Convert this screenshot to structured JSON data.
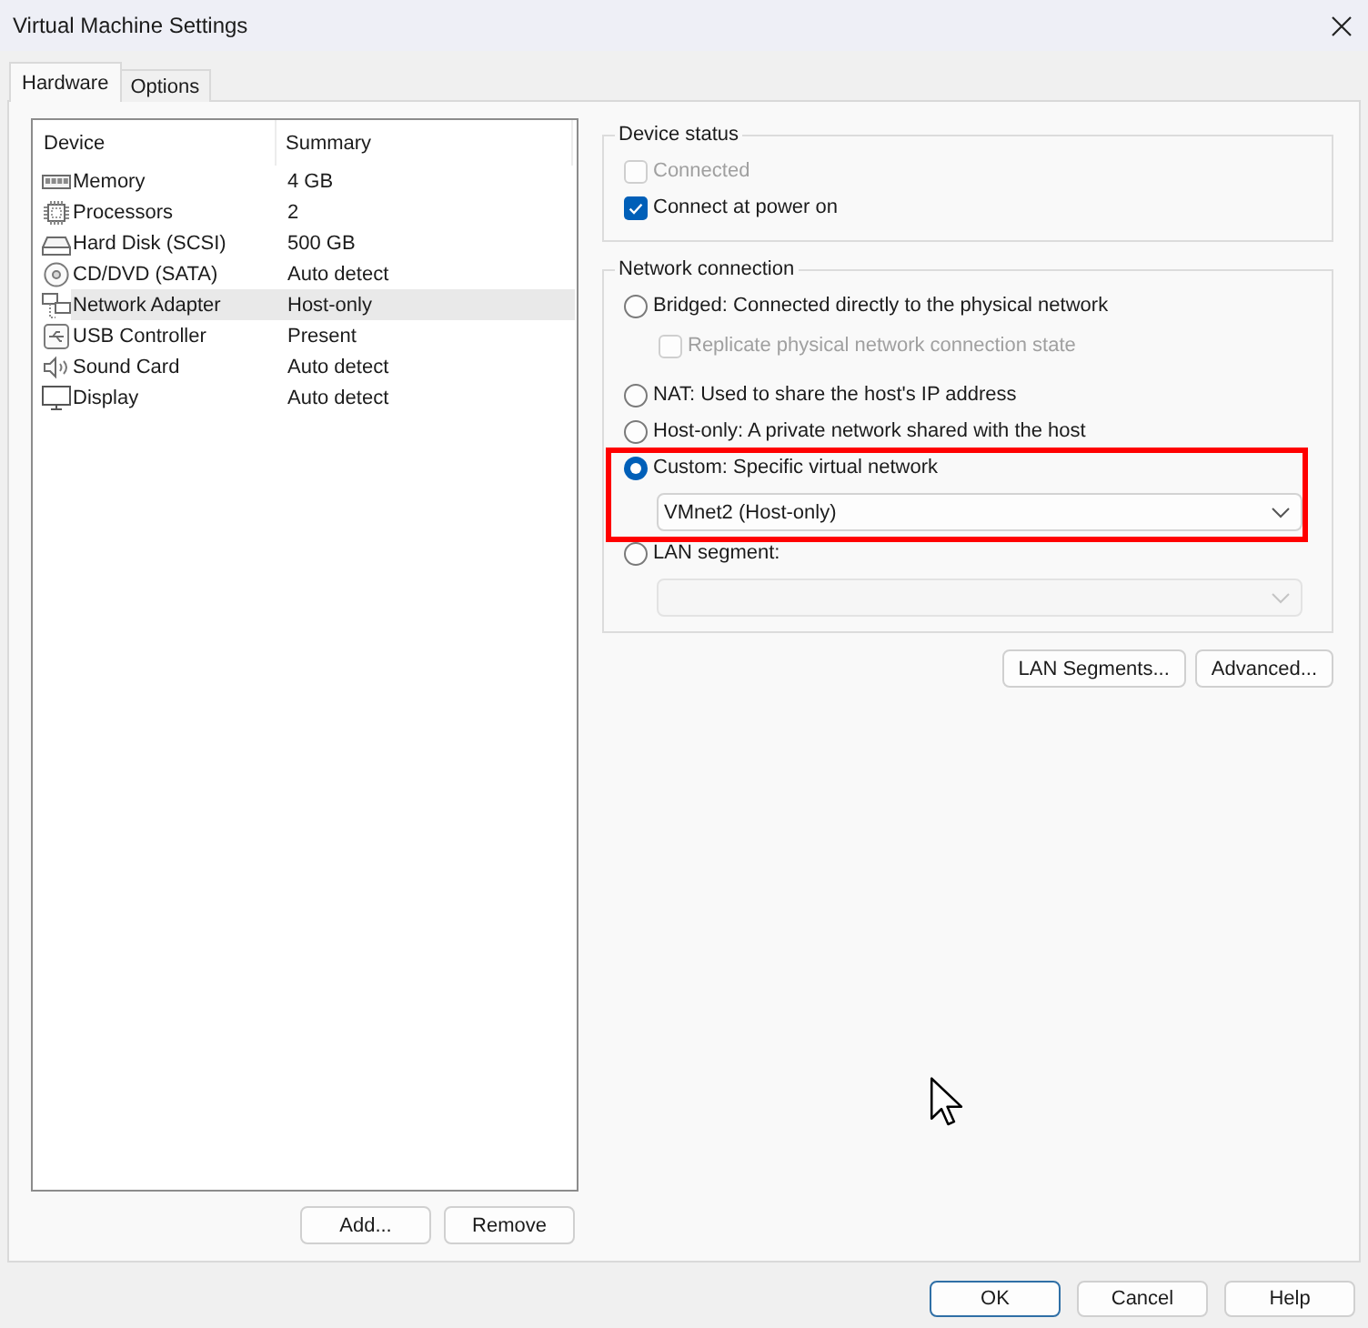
{
  "window": {
    "title": "Virtual Machine Settings"
  },
  "tabs": [
    {
      "label": "Hardware",
      "selected": true
    },
    {
      "label": "Options",
      "selected": false
    }
  ],
  "device_list": {
    "columns": [
      "Device",
      "Summary"
    ],
    "rows": [
      {
        "kind": "memory",
        "device": "Memory",
        "summary": "4 GB",
        "selected": false
      },
      {
        "kind": "processor",
        "device": "Processors",
        "summary": "2",
        "selected": false
      },
      {
        "kind": "hard_disk",
        "device": "Hard Disk (SCSI)",
        "summary": "500 GB",
        "selected": false
      },
      {
        "kind": "cd",
        "device": "CD/DVD (SATA)",
        "summary": "Auto detect",
        "selected": false
      },
      {
        "kind": "network",
        "device": "Network Adapter",
        "summary": "Host-only",
        "selected": true
      },
      {
        "kind": "usb",
        "device": "USB Controller",
        "summary": "Present",
        "selected": false
      },
      {
        "kind": "sound",
        "device": "Sound Card",
        "summary": "Auto detect",
        "selected": false
      },
      {
        "kind": "display",
        "device": "Display",
        "summary": "Auto detect",
        "selected": false
      }
    ]
  },
  "list_buttons": [
    "Add...",
    "Remove"
  ],
  "device_status": {
    "title": "Device status",
    "options": [
      {
        "label": "Connected",
        "checked": false,
        "disabled": true
      },
      {
        "label": "Connect at power on",
        "checked": true,
        "disabled": false
      }
    ]
  },
  "network_connection": {
    "title": "Network connection",
    "options": [
      {
        "label": "Bridged: Connected directly to the physical network",
        "selected": false,
        "highlighted": false,
        "sub_option": {
          "label": "Replicate physical network connection state",
          "checked": false,
          "disabled": true
        }
      },
      {
        "label": "NAT: Used to share the host's IP address",
        "selected": false,
        "highlighted": false
      },
      {
        "label": "Host-only: A private network shared with the host",
        "selected": false,
        "highlighted": false
      },
      {
        "label": "Custom: Specific virtual network",
        "selected": true,
        "highlighted": true,
        "dropdown": {
          "value": "VMnet2 (Host-only)",
          "disabled": false
        }
      },
      {
        "label": "LAN segment:",
        "selected": false,
        "highlighted": false,
        "dropdown": {
          "disabled": true
        }
      }
    ]
  },
  "network_buttons": [
    "LAN Segments...",
    "Advanced..."
  ],
  "dialog_buttons": [
    {
      "label": "OK",
      "default": true
    },
    {
      "label": "Cancel",
      "default": false
    },
    {
      "label": "Help",
      "default": false
    }
  ]
}
